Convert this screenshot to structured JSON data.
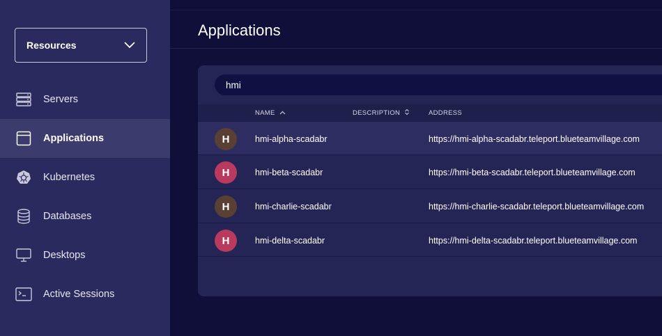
{
  "sidebar": {
    "dropdown_label": "Resources",
    "items": [
      {
        "label": "Servers",
        "icon": "server-icon",
        "active": false
      },
      {
        "label": "Applications",
        "icon": "application-icon",
        "active": true
      },
      {
        "label": "Kubernetes",
        "icon": "kubernetes-icon",
        "active": false
      },
      {
        "label": "Databases",
        "icon": "database-icon",
        "active": false
      },
      {
        "label": "Desktops",
        "icon": "desktop-icon",
        "active": false
      },
      {
        "label": "Active Sessions",
        "icon": "terminal-icon",
        "active": false
      }
    ]
  },
  "header": {
    "title": "Applications"
  },
  "search": {
    "value": "hmi"
  },
  "table": {
    "columns": {
      "name": "NAME",
      "description": "DESCRIPTION",
      "address": "ADDRESS"
    },
    "rows": [
      {
        "avatar": "H",
        "avatar_color": "#5a3f35",
        "name": "hmi-alpha-scadabr",
        "description": "",
        "address": "https://hmi-alpha-scadabr.teleport.blueteamvillage.com"
      },
      {
        "avatar": "H",
        "avatar_color": "#b83a5e",
        "name": "hmi-beta-scadabr",
        "description": "",
        "address": "https://hmi-beta-scadabr.teleport.blueteamvillage.com"
      },
      {
        "avatar": "H",
        "avatar_color": "#5a3f35",
        "name": "hmi-charlie-scadabr",
        "description": "",
        "address": "https://hmi-charlie-scadabr.teleport.blueteamvillage.com"
      },
      {
        "avatar": "H",
        "avatar_color": "#b83a5e",
        "name": "hmi-delta-scadabr",
        "description": "",
        "address": "https://hmi-delta-scadabr.teleport.blueteamvillage.com"
      }
    ]
  },
  "colors": {
    "background": "#0f0f3a",
    "sidebar": "#2a2a5e",
    "sidebar_active": "#3b3b6e",
    "card": "#252555"
  }
}
